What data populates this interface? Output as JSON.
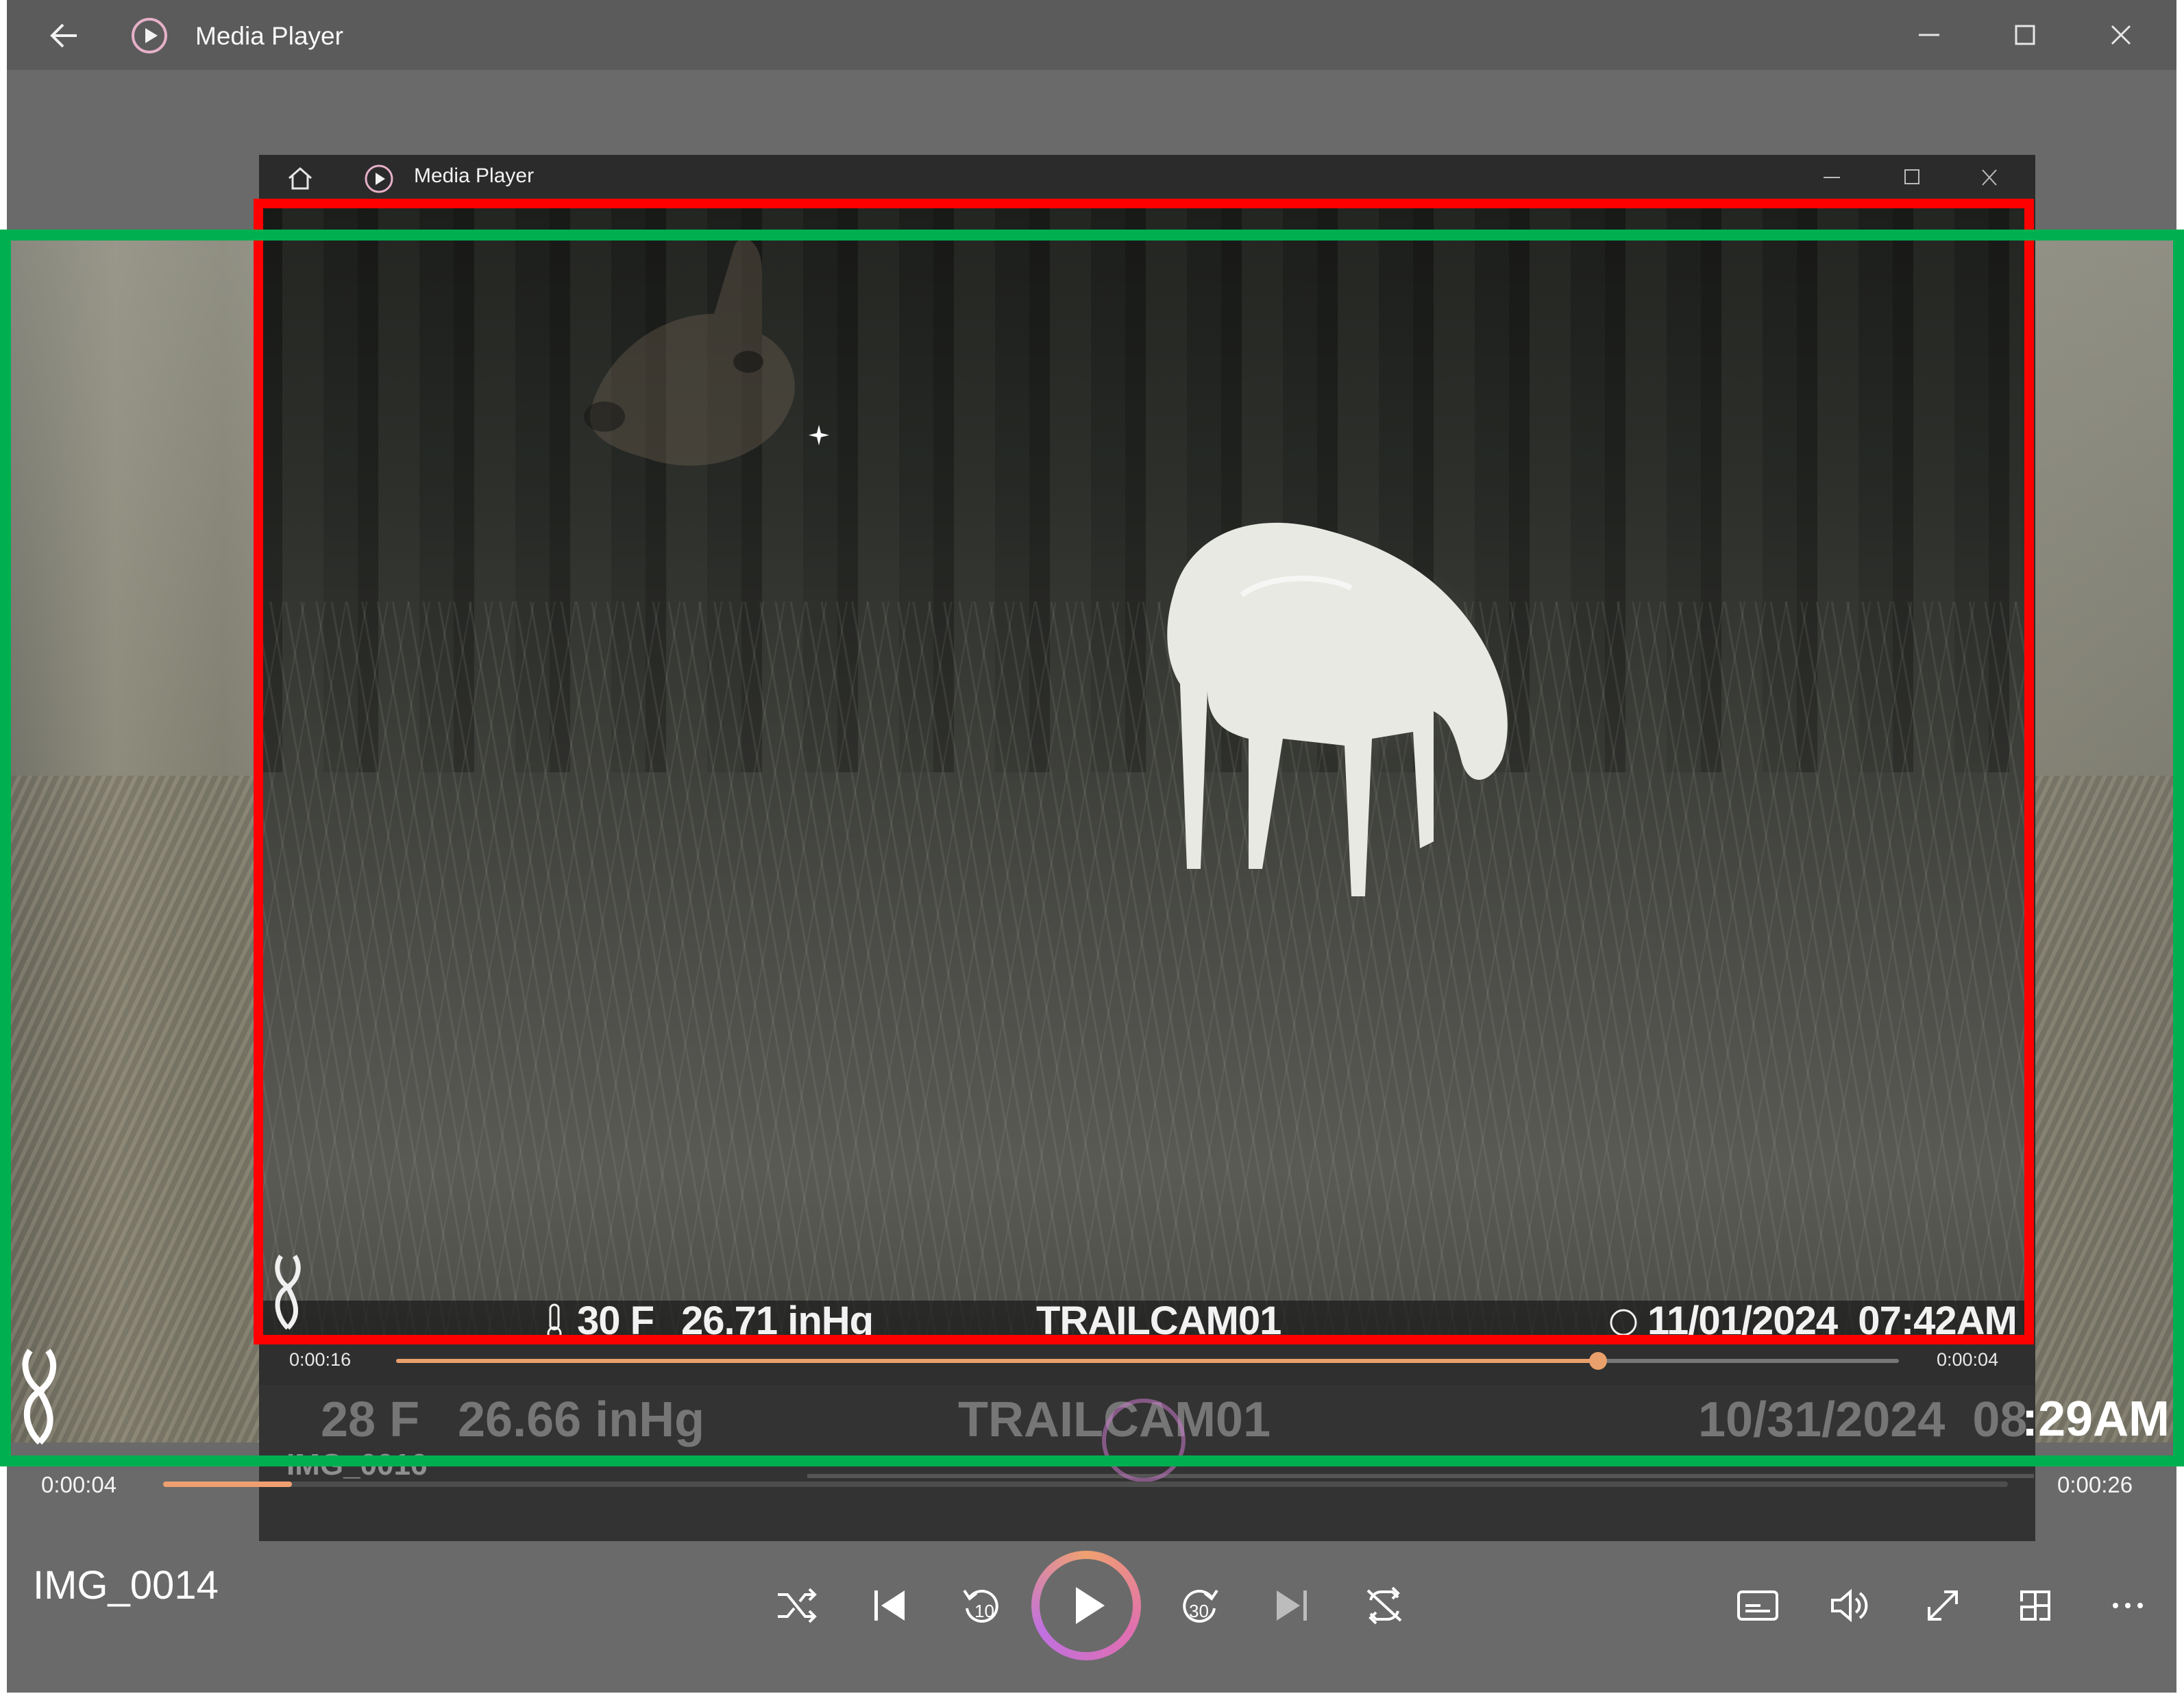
{
  "window": {
    "title": "Media Player",
    "back_icon": "back-arrow-icon",
    "minimize_icon": "minimize-icon",
    "maximize_icon": "maximize-icon",
    "close_icon": "close-icon"
  },
  "inner_window": {
    "title": "Media Player",
    "home_icon": "home-icon",
    "elapsed": "0:00:16",
    "remaining": "0:00:04",
    "progress": 0.8,
    "overlay": {
      "temperature": "30 F",
      "pressure": "26.71 inHg",
      "camera": "TRAILCAM01",
      "datetime": "11/01/2024  07:42AM"
    }
  },
  "ghost_overlay": {
    "temperature": "28 F",
    "pressure": "26.66 inHg",
    "camera": "TRAILCAM01",
    "datetime": "10/31/2024  08",
    "time_tail": ":29AM",
    "title_fragment": "IMG_0016"
  },
  "player": {
    "media_title": "IMG_0014",
    "elapsed": "0:00:04",
    "remaining": "0:00:26",
    "progress": 0.07,
    "skip_back_seconds": "10",
    "skip_forward_seconds": "30"
  },
  "colors": {
    "accent": "#f0a070",
    "highlight_red": "#ff0000",
    "highlight_green": "#00b050"
  }
}
